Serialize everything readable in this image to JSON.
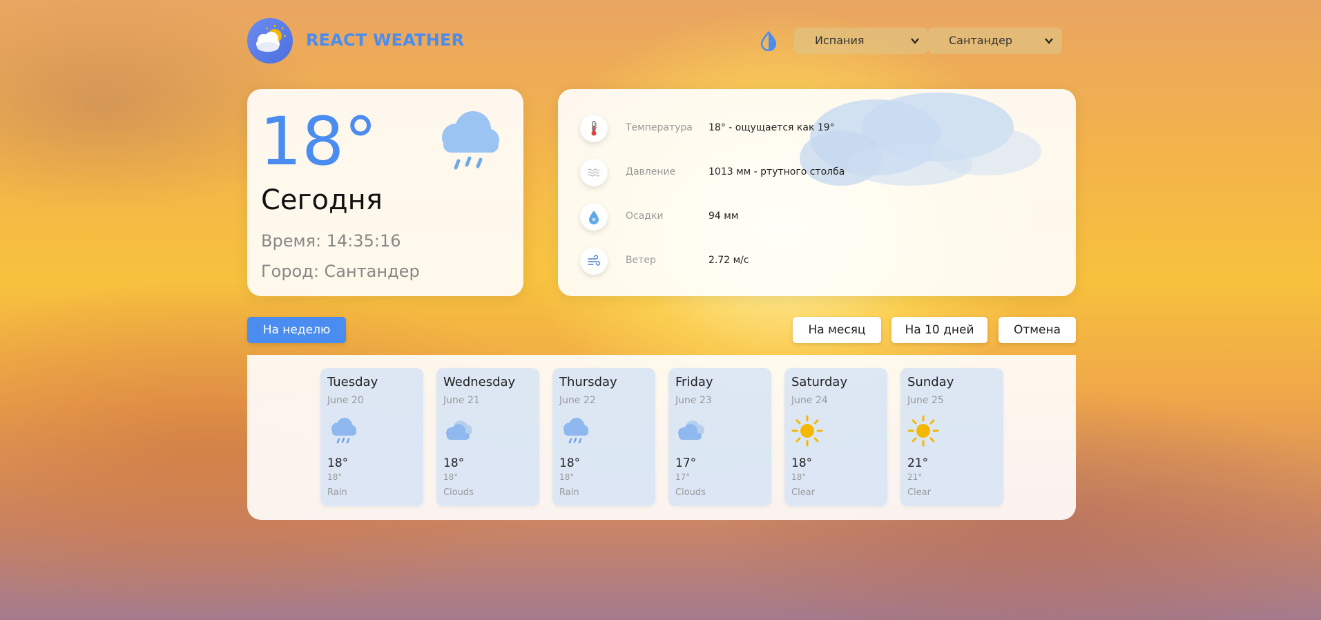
{
  "header": {
    "app_title": "REACT WEATHER",
    "country_select": {
      "value": "Испания"
    },
    "city_select": {
      "value": "Сантандер"
    }
  },
  "today": {
    "temperature": "18°",
    "title": "Сегодня",
    "time": "Время: 14:35:16",
    "city": "Город: Сантандер",
    "icon": "rain-icon"
  },
  "details": [
    {
      "icon": "thermometer-icon",
      "label": "Температура",
      "value": "18° - ощущается как 19°"
    },
    {
      "icon": "pressure-icon",
      "label": "Давление",
      "value": "1013 мм - ртутного столба"
    },
    {
      "icon": "precipitation-icon",
      "label": "Осадки",
      "value": "94 мм"
    },
    {
      "icon": "wind-icon",
      "label": "Ветер",
      "value": "2.72 м/с"
    }
  ],
  "tabs": {
    "week": "На неделю",
    "month": "На месяц",
    "ten_days": "На 10 дней",
    "cancel": "Отмена"
  },
  "forecast": [
    {
      "day": "Tuesday",
      "date": "June 20",
      "temp": "18°",
      "feels": "18°",
      "desc": "Rain",
      "icon": "rain-icon"
    },
    {
      "day": "Wednesday",
      "date": "June 21",
      "temp": "18°",
      "feels": "18°",
      "desc": "Clouds",
      "icon": "clouds-icon"
    },
    {
      "day": "Thursday",
      "date": "June 22",
      "temp": "18°",
      "feels": "18°",
      "desc": "Rain",
      "icon": "rain-icon"
    },
    {
      "day": "Friday",
      "date": "June 23",
      "temp": "17°",
      "feels": "17°",
      "desc": "Clouds",
      "icon": "clouds-icon"
    },
    {
      "day": "Saturday",
      "date": "June 24",
      "temp": "18°",
      "feels": "18°",
      "desc": "Clear",
      "icon": "sun-icon"
    },
    {
      "day": "Sunday",
      "date": "June 25",
      "temp": "21°",
      "feels": "21°",
      "desc": "Clear",
      "icon": "sun-icon"
    }
  ],
  "colors": {
    "accent": "#4a8cef",
    "card_bg": "#ffffff",
    "day_card_bg": "#d2e1f5",
    "sun": "#f5b800"
  }
}
